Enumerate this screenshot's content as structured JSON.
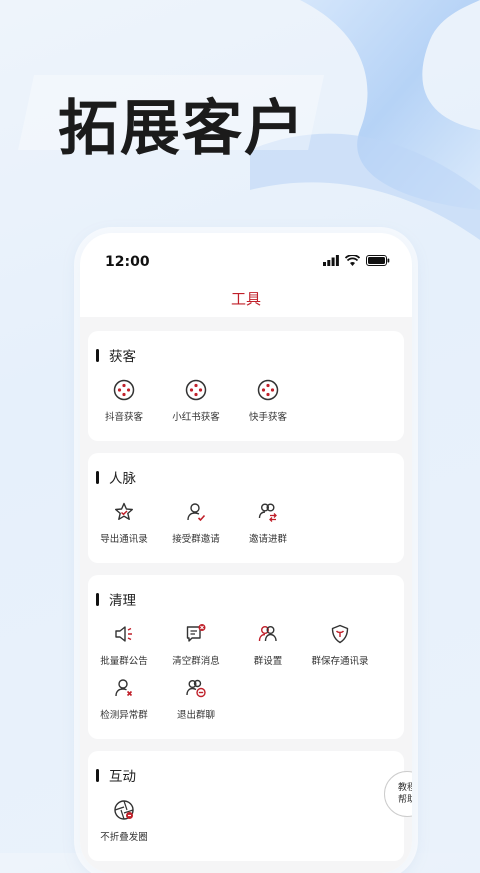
{
  "hero": {
    "title": "拓展客户"
  },
  "status_bar": {
    "time": "12:00"
  },
  "top_tab": {
    "label": "工具"
  },
  "sections": [
    {
      "title": "获客",
      "items": [
        {
          "label": "抖音获客",
          "icon": "reel-icon"
        },
        {
          "label": "小红书获客",
          "icon": "reel-icon"
        },
        {
          "label": "快手获客",
          "icon": "reel-icon"
        }
      ]
    },
    {
      "title": "人脉",
      "items": [
        {
          "label": "导出通讯录",
          "icon": "star-export-icon"
        },
        {
          "label": "接受群邀请",
          "icon": "user-check-icon"
        },
        {
          "label": "邀请进群",
          "icon": "users-arrow-icon"
        }
      ]
    },
    {
      "title": "清理",
      "items": [
        {
          "label": "批量群公告",
          "icon": "megaphone-icon"
        },
        {
          "label": "清空群消息",
          "icon": "message-clear-icon"
        },
        {
          "label": "群设置",
          "icon": "group-settings-icon"
        },
        {
          "label": "群保存通讯录",
          "icon": "shield-save-icon"
        },
        {
          "label": "检测异常群",
          "icon": "user-x-icon"
        },
        {
          "label": "退出群聊",
          "icon": "group-exit-icon"
        }
      ]
    },
    {
      "title": "互动",
      "items": [
        {
          "label": "不折叠发圈",
          "icon": "aperture-icon"
        }
      ]
    }
  ],
  "help_button": {
    "line1": "教程",
    "line2": "帮助"
  },
  "colors": {
    "accent": "#c0202a",
    "icon_dark": "#333333",
    "background": "#f5f5f6"
  }
}
